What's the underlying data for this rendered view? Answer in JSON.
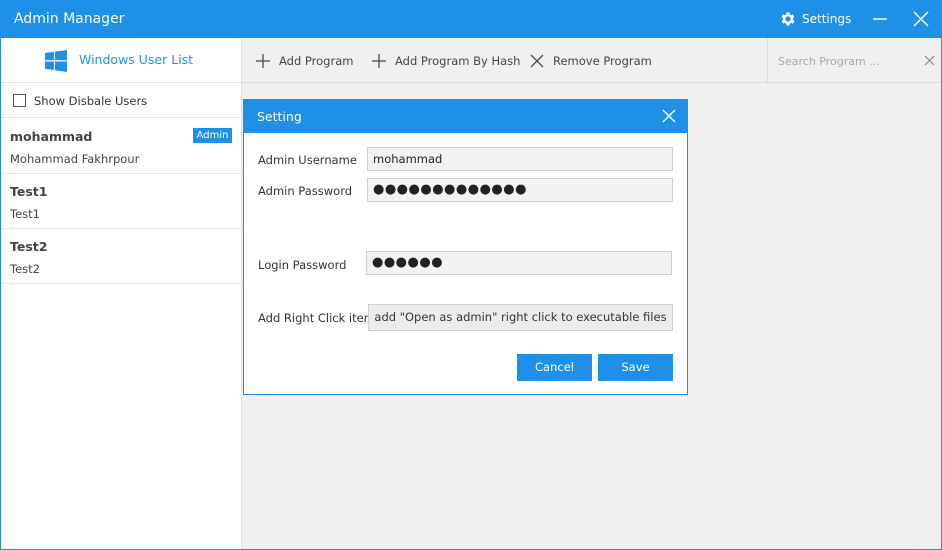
{
  "window": {
    "title": "Admin Manager",
    "settings_label": "Settings",
    "accent_color": "#1e90e8"
  },
  "sidebar": {
    "header_label": "Windows User List",
    "show_disabled_label": "Show Disbale Users",
    "show_disabled_checked": false,
    "users": [
      {
        "username": "mohammad",
        "full_name": "Mohammad Fakhrpour",
        "badge": "Admin"
      },
      {
        "username": "Test1",
        "full_name": "Test1"
      },
      {
        "username": "Test2",
        "full_name": "Test2"
      }
    ]
  },
  "toolbar": {
    "add_program": "Add Program",
    "add_program_by_hash": "Add Program By Hash",
    "remove_program": "Remove Program",
    "search_placeholder": "Search Program ..."
  },
  "dialog": {
    "title": "Setting",
    "admin_username_label": "Admin Username",
    "admin_username_value": "mohammad",
    "admin_password_label": "Admin Password",
    "admin_password_value": "●●●●●●●●●●●●●",
    "login_password_label": "Login Password",
    "login_password_value": "●●●●●●",
    "right_click_label": "Add Right Click item",
    "right_click_button": "add \"Open as admin\" right click to executable files",
    "cancel_label": "Cancel",
    "save_label": "Save"
  }
}
